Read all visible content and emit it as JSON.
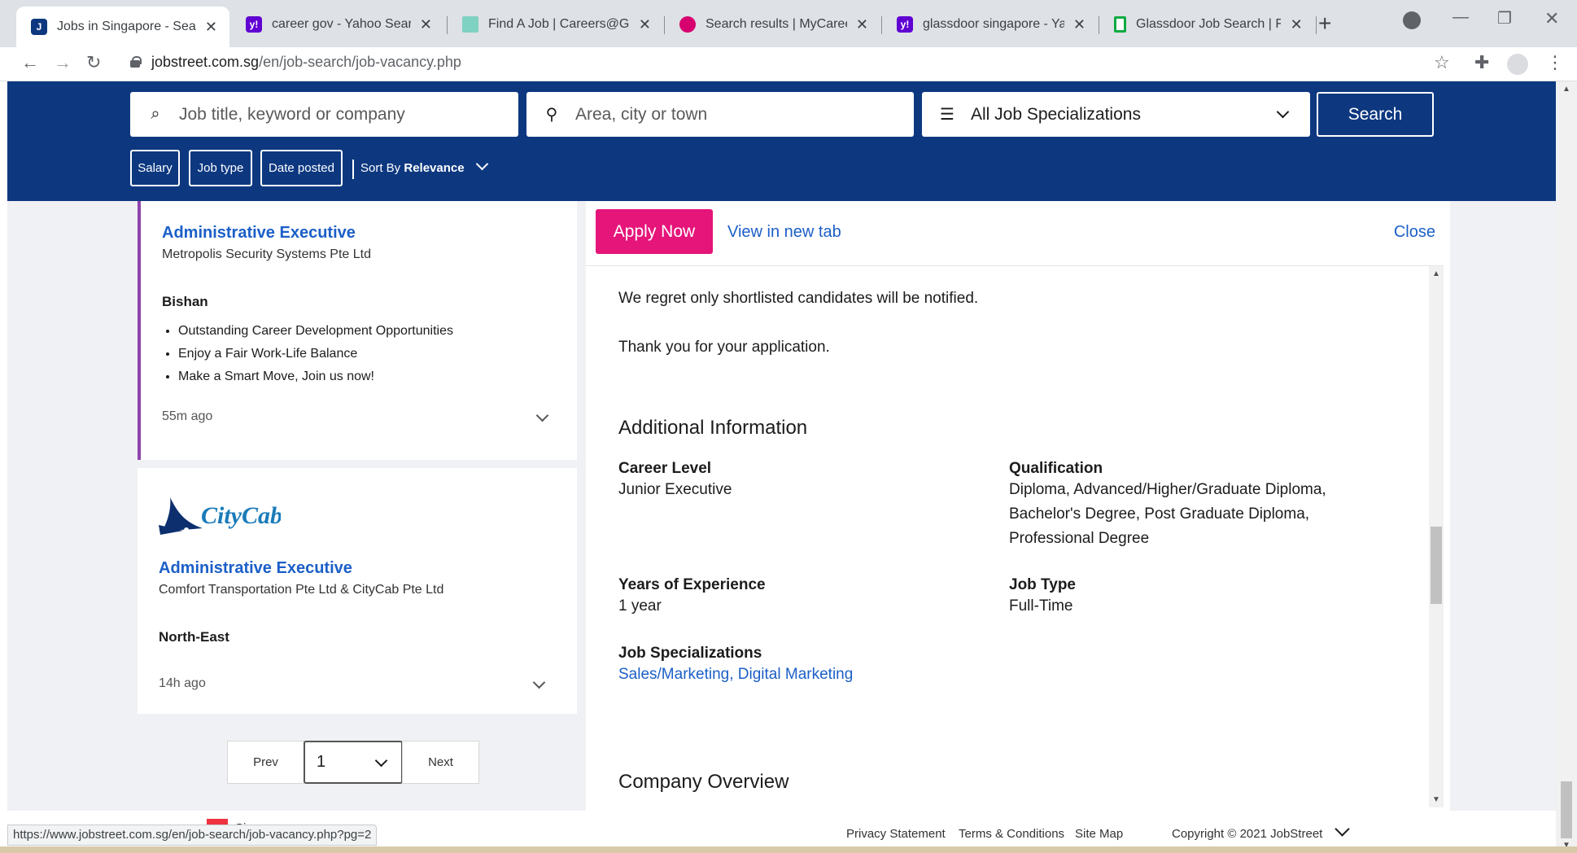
{
  "browser": {
    "tabs": [
      {
        "title": "Jobs in Singapore - Search Jobs",
        "favicon_text": "J",
        "favicon_color": "#0d3880",
        "active": true
      },
      {
        "title": "career gov - Yahoo Search Results",
        "favicon_text": "y!",
        "favicon_color": "#6001d2",
        "active": false
      },
      {
        "title": "Find A Job | Careers@Gov",
        "favicon_text": "",
        "favicon_color": "#7fd1c1",
        "active": false
      },
      {
        "title": "Search results | MyCareersFuture",
        "favicon_text": "",
        "favicon_color": "#d6006f",
        "active": false
      },
      {
        "title": "glassdoor singapore - Yahoo Search",
        "favicon_text": "y!",
        "favicon_color": "#6001d2",
        "active": false
      },
      {
        "title": "Glassdoor Job Search | Find Jobs",
        "favicon_text": "",
        "favicon_color": "#0caa41",
        "active": false
      }
    ],
    "url_host": "jobstreet.com.sg",
    "url_path": "/en/job-search/job-vacancy.php",
    "status_url": "https://www.jobstreet.com.sg/en/job-search/job-vacancy.php?pg=2"
  },
  "search": {
    "keyword_placeholder": "Job title, keyword or company",
    "location_placeholder": "Area, city or town",
    "specialization": "All Job Specializations",
    "button": "Search",
    "filters": [
      "Salary",
      "Job type",
      "Date posted"
    ],
    "sort_prefix": "Sort By",
    "sort_value": "Relevance"
  },
  "job_list": [
    {
      "title": "Administrative Executive",
      "company": "Metropolis Security Systems Pte Ltd",
      "location": "Bishan",
      "highlights": [
        "Outstanding Career Development Opportunities",
        "Enjoy a Fair Work-Life Balance",
        "Make a Smart Move, Join us now!"
      ],
      "posted": "55m ago"
    },
    {
      "logo": "CityCab",
      "title": "Administrative Executive",
      "company": "Comfort Transportation Pte Ltd & CityCab Pte Ltd",
      "location": "North-East",
      "posted": "14h ago"
    }
  ],
  "pagination": {
    "prev": "Prev",
    "page": "1",
    "next": "Next"
  },
  "detail": {
    "apply": "Apply Now",
    "view_new_tab": "View in new tab",
    "close": "Close",
    "regret": "We regret only shortlisted candidates will be notified.",
    "thanks": "Thank you for your application.",
    "additional_heading": "Additional Information",
    "career_level_label": "Career Level",
    "career_level": "Junior Executive",
    "qualification_label": "Qualification",
    "qualification_lines": [
      "Diploma, Advanced/Higher/Graduate Diploma,",
      "Bachelor's Degree, Post Graduate Diploma,",
      "Professional Degree"
    ],
    "experience_label": "Years of Experience",
    "experience": "1 year",
    "job_type_label": "Job Type",
    "job_type": "Full-Time",
    "specializations_label": "Job Specializations",
    "specialization_1": "Sales/Marketing",
    "specialization_sep": ", ",
    "specialization_2": "Digital Marketing",
    "company_overview": "Company Overview"
  },
  "footer": {
    "country": "Singapore",
    "privacy": "Privacy Statement",
    "terms": "Terms & Conditions",
    "sitemap": "Site Map",
    "copyright": "Copyright © 2021 JobStreet"
  },
  "colors": {
    "brand_navy": "#0d3880",
    "apply_pink": "#e5157a",
    "link_blue": "#1b5fc7",
    "selected_border": "#8e44ad"
  }
}
